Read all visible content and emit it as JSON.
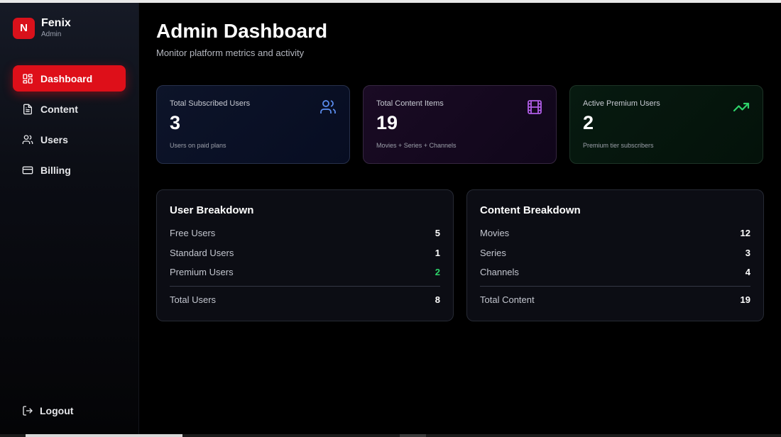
{
  "brand": {
    "logo_letter": "N",
    "name": "Fenix",
    "role": "Admin",
    "color": "#d9111b"
  },
  "nav": {
    "items": [
      {
        "label": "Dashboard",
        "icon": "dashboard-icon",
        "active": true
      },
      {
        "label": "Content",
        "icon": "document-icon",
        "active": false
      },
      {
        "label": "Users",
        "icon": "users-icon",
        "active": false
      },
      {
        "label": "Billing",
        "icon": "credit-card-icon",
        "active": false
      }
    ],
    "logout_label": "Logout",
    "logout_icon": "logout-icon"
  },
  "header": {
    "title": "Admin Dashboard",
    "subtitle": "Monitor platform metrics and activity"
  },
  "stats": [
    {
      "label": "Total Subscribed Users",
      "value": "3",
      "sub": "Users on paid plans",
      "icon": "users-icon",
      "icon_color": "#5b8def"
    },
    {
      "label": "Total Content Items",
      "value": "19",
      "sub": "Movies + Series + Channels",
      "icon": "film-icon",
      "icon_color": "#b05de6"
    },
    {
      "label": "Active Premium Users",
      "value": "2",
      "sub": "Premium tier subscribers",
      "icon": "trending-up-icon",
      "icon_color": "#2ed36a"
    }
  ],
  "user_breakdown": {
    "title": "User Breakdown",
    "rows": [
      {
        "label": "Free Users",
        "value": "5"
      },
      {
        "label": "Standard Users",
        "value": "1"
      },
      {
        "label": "Premium Users",
        "value": "2"
      }
    ],
    "total_label": "Total Users",
    "total_value": "8"
  },
  "content_breakdown": {
    "title": "Content Breakdown",
    "rows": [
      {
        "label": "Movies",
        "value": "12"
      },
      {
        "label": "Series",
        "value": "3"
      },
      {
        "label": "Channels",
        "value": "4"
      }
    ],
    "total_label": "Total Content",
    "total_value": "19"
  },
  "colors": {
    "accent": "#de0f19",
    "premium_green": "#2ed36a"
  }
}
